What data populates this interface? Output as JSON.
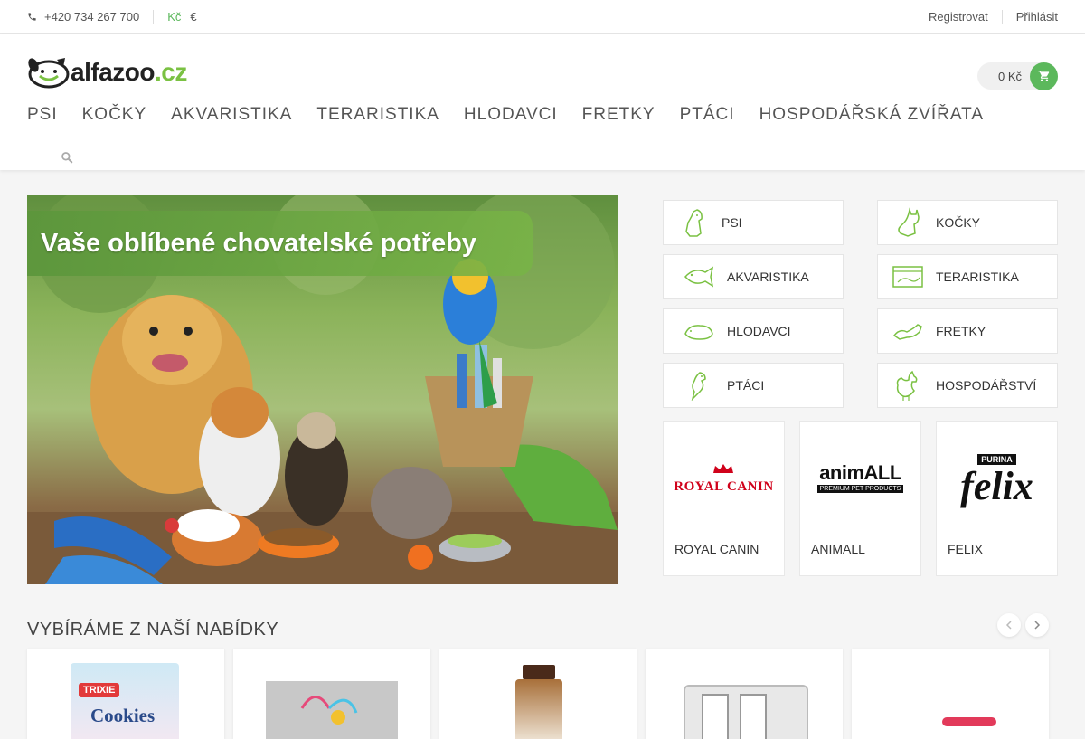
{
  "topbar": {
    "phone": "+420 734 267 700",
    "currency_czk": "Kč",
    "currency_eur": "€",
    "register": "Registrovat",
    "login": "Přihlásit"
  },
  "logo": {
    "text_main": "alfazoo",
    "text_tld": ".cz"
  },
  "cart": {
    "total": "0 Kč"
  },
  "nav": [
    "PSI",
    "KOČKY",
    "AKVARISTIKA",
    "TERARISTIKA",
    "HLODAVCI",
    "FRETKY",
    "PTÁCI",
    "HOSPODÁŘSKÁ ZVÍŘATA"
  ],
  "hero": {
    "headline": "Vaše oblíbené chovatelské potřeby"
  },
  "categories": [
    {
      "label": "PSI",
      "icon": "dog-icon"
    },
    {
      "label": "KOČKY",
      "icon": "cat-icon"
    },
    {
      "label": "AKVARISTIKA",
      "icon": "fish-icon"
    },
    {
      "label": "TERARISTIKA",
      "icon": "terrarium-icon"
    },
    {
      "label": "HLODAVCI",
      "icon": "rodent-icon"
    },
    {
      "label": "FRETKY",
      "icon": "ferret-icon"
    },
    {
      "label": "PTÁCI",
      "icon": "bird-icon"
    },
    {
      "label": "HOSPODÁŘSTVÍ",
      "icon": "rooster-icon"
    }
  ],
  "brands": [
    {
      "name": "ROYAL CANIN",
      "logo_text": "ROYAL CANIN"
    },
    {
      "name": "ANIMALL",
      "logo_text": "animALL",
      "logo_sub": "PREMIUM PET PRODUCTS"
    },
    {
      "name": "FELIX",
      "logo_text": "felix",
      "logo_top": "PURINA"
    }
  ],
  "featured": {
    "title": "VYBÍRÁME Z NAŠÍ NABÍDKY",
    "product_label": "Cookies",
    "product_brand": "TRIXIE"
  },
  "colors": {
    "accent": "#5cb85c",
    "brand_green": "#7ac142",
    "royal_canin_red": "#d0021b"
  }
}
